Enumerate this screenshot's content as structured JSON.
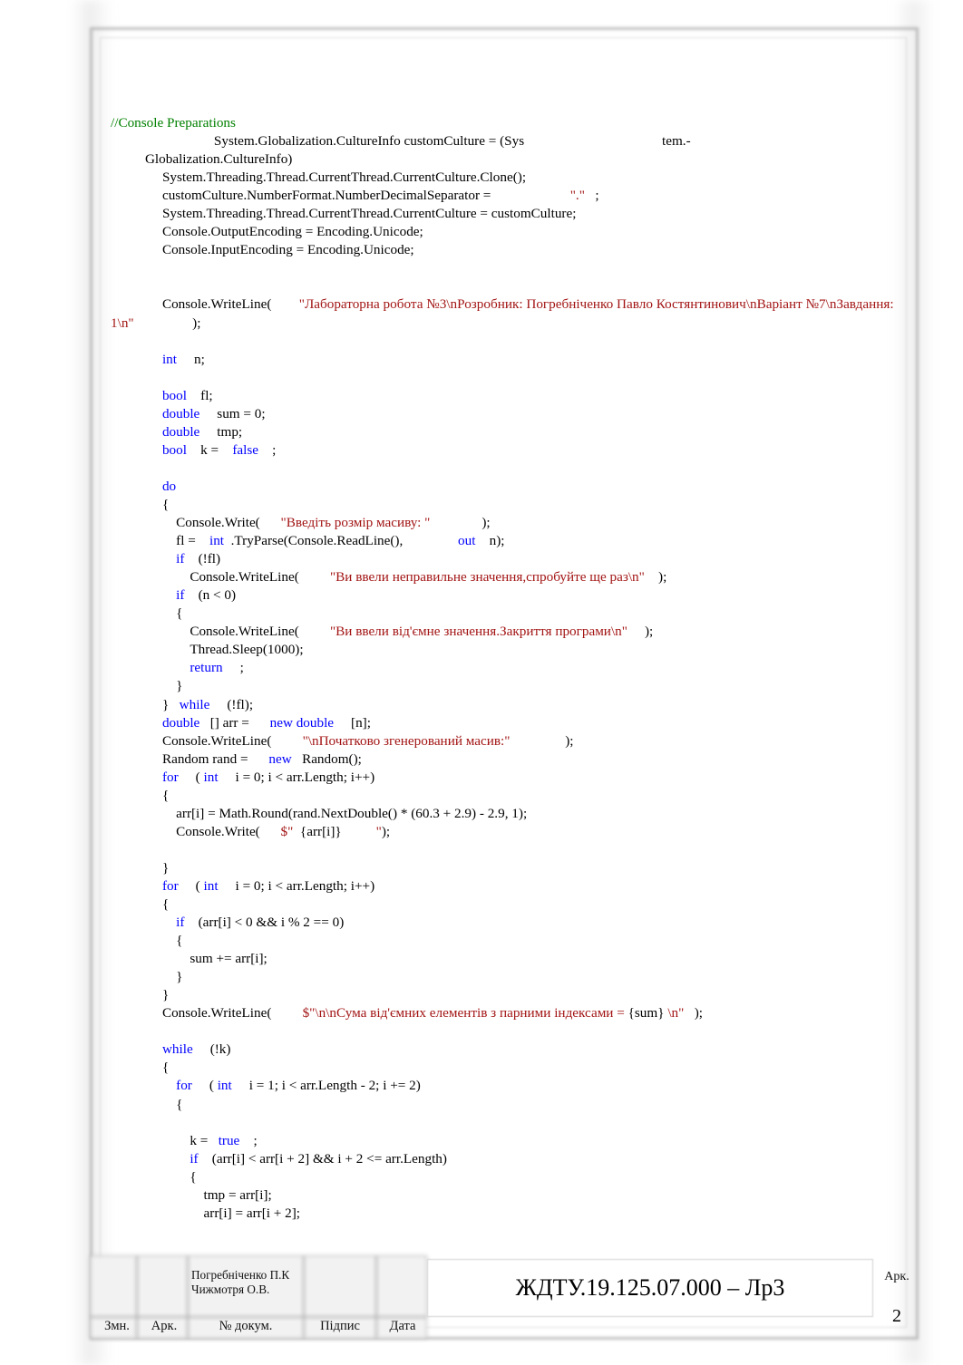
{
  "document": {
    "page_number": "2",
    "colors": {
      "keyword": "#0000ff",
      "string": "#a31515",
      "comment": "#008000",
      "plain": "#000000"
    }
  },
  "code": {
    "lines": [
      [
        {
          "t": "cmt",
          "s": "//Console Preparations"
        }
      ],
      [
        {
          "t": "pln",
          "s": "                              System.Globalization.CultureInfo customCulture = (Sys"
        },
        {
          "t": "pln",
          "s": "                                        tem.-"
        }
      ],
      [
        {
          "t": "pln",
          "s": "          Globalization.CultureInfo)"
        }
      ],
      [
        {
          "t": "pln",
          "s": "               System.Threading.Thread.CurrentThread.CurrentCulture.Clone();"
        }
      ],
      [
        {
          "t": "pln",
          "s": "               customCulture.NumberFormat.NumberDecimalSeparator = "
        },
        {
          "t": "str",
          "s": "                      \".\""
        },
        {
          "t": "pln",
          "s": "   ;"
        }
      ],
      [
        {
          "t": "pln",
          "s": "               System.Threading.Thread.CurrentThread.CurrentCulture = customCulture;"
        }
      ],
      [
        {
          "t": "pln",
          "s": "               Console.OutputEncoding = Encoding.Unicode;"
        }
      ],
      [
        {
          "t": "pln",
          "s": "               Console.InputEncoding = Encoding.Unicode;"
        }
      ],
      [],
      [],
      [
        {
          "t": "pln",
          "s": "               Console.WriteLine("
        },
        {
          "t": "str",
          "s": "        \"Лабораторна робота №3\\nРозробник: Погребніченко Павло Костянтинович\\nВаріант №7\\nЗавдання: 1\\n\""
        },
        {
          "t": "pln",
          "s": "                 );"
        }
      ],
      [],
      [
        {
          "t": "kw",
          "s": "               int"
        },
        {
          "t": "pln",
          "s": "     n;"
        }
      ],
      [],
      [
        {
          "t": "kw",
          "s": "               bool"
        },
        {
          "t": "pln",
          "s": "    fl;"
        }
      ],
      [
        {
          "t": "kw",
          "s": "               double"
        },
        {
          "t": "pln",
          "s": "     sum = 0;"
        }
      ],
      [
        {
          "t": "kw",
          "s": "               double"
        },
        {
          "t": "pln",
          "s": "     tmp;"
        }
      ],
      [
        {
          "t": "kw",
          "s": "               bool"
        },
        {
          "t": "pln",
          "s": "    k = "
        },
        {
          "t": "kw",
          "s": "   false"
        },
        {
          "t": "pln",
          "s": "    ;"
        }
      ],
      [],
      [
        {
          "t": "kw",
          "s": "               do"
        }
      ],
      [
        {
          "t": "pln",
          "s": "               {"
        }
      ],
      [
        {
          "t": "pln",
          "s": "                   Console.Write("
        },
        {
          "t": "str",
          "s": "      \"Введіть розмір масиву: \""
        },
        {
          "t": "pln",
          "s": "               );"
        }
      ],
      [
        {
          "t": "pln",
          "s": "                   fl = "
        },
        {
          "t": "kw",
          "s": "   int"
        },
        {
          "t": "pln",
          "s": "  .TryParse(Console.ReadLine(),                "
        },
        {
          "t": "kw",
          "s": "out"
        },
        {
          "t": "pln",
          "s": "    n);"
        }
      ],
      [
        {
          "t": "kw",
          "s": "                   if"
        },
        {
          "t": "pln",
          "s": "    (!fl)"
        }
      ],
      [
        {
          "t": "pln",
          "s": "                       Console.WriteLine("
        },
        {
          "t": "str",
          "s": "         \"Ви ввели неправильне значення,спробуйте ще раз\\n\""
        },
        {
          "t": "pln",
          "s": "    );"
        }
      ],
      [
        {
          "t": "kw",
          "s": "                   if"
        },
        {
          "t": "pln",
          "s": "    (n < 0)"
        }
      ],
      [
        {
          "t": "pln",
          "s": "                   {"
        }
      ],
      [
        {
          "t": "pln",
          "s": "                       Console.WriteLine("
        },
        {
          "t": "str",
          "s": "         \"Ви ввели від'ємне значення.Закриття програми\\n\""
        },
        {
          "t": "pln",
          "s": "     );"
        }
      ],
      [
        {
          "t": "pln",
          "s": "                       Thread.Sleep(1000);"
        }
      ],
      [
        {
          "t": "kw",
          "s": "                       return"
        },
        {
          "t": "pln",
          "s": "     ;"
        }
      ],
      [
        {
          "t": "pln",
          "s": "                   }"
        }
      ],
      [
        {
          "t": "pln",
          "s": "               } "
        },
        {
          "t": "kw",
          "s": "  while"
        },
        {
          "t": "pln",
          "s": "     (!fl);"
        }
      ],
      [
        {
          "t": "kw",
          "s": "               double"
        },
        {
          "t": "pln",
          "s": "   [] arr = "
        },
        {
          "t": "kw",
          "s": "     new double"
        },
        {
          "t": "pln",
          "s": "     [n];"
        }
      ],
      [
        {
          "t": "pln",
          "s": "               Console.WriteLine("
        },
        {
          "t": "str",
          "s": "         \"\\nПочатково згенерований масив:\""
        },
        {
          "t": "pln",
          "s": "                );"
        }
      ],
      [
        {
          "t": "pln",
          "s": "               Random rand = "
        },
        {
          "t": "kw",
          "s": "     new"
        },
        {
          "t": "pln",
          "s": "   Random();"
        }
      ],
      [
        {
          "t": "kw",
          "s": "               for"
        },
        {
          "t": "pln",
          "s": "     ( "
        },
        {
          "t": "kw",
          "s": "int"
        },
        {
          "t": "pln",
          "s": "     i = 0; i < arr.Length; i++)"
        }
      ],
      [
        {
          "t": "pln",
          "s": "               {"
        }
      ],
      [
        {
          "t": "pln",
          "s": "                   arr[i] = Math.Round(rand.NextDouble() * (60.3 + 2.9) - 2.9, 1);"
        }
      ],
      [
        {
          "t": "pln",
          "s": "                   Console.Write("
        },
        {
          "t": "str",
          "s": "      $\""
        },
        {
          "t": "pln",
          "s": "  {arr[i]}"
        },
        {
          "t": "str",
          "s": "          \""
        },
        {
          "t": "pln",
          "s": ");"
        }
      ],
      [],
      [
        {
          "t": "pln",
          "s": "               }"
        }
      ],
      [
        {
          "t": "kw",
          "s": "               for"
        },
        {
          "t": "pln",
          "s": "     ( "
        },
        {
          "t": "kw",
          "s": "int"
        },
        {
          "t": "pln",
          "s": "     i = 0; i < arr.Length; i++)"
        }
      ],
      [
        {
          "t": "pln",
          "s": "               {"
        }
      ],
      [
        {
          "t": "kw",
          "s": "                   if"
        },
        {
          "t": "pln",
          "s": "    (arr[i] < 0 && i % 2 == 0)"
        }
      ],
      [
        {
          "t": "pln",
          "s": "                   {"
        }
      ],
      [
        {
          "t": "pln",
          "s": "                       sum += arr[i];"
        }
      ],
      [
        {
          "t": "pln",
          "s": "                   }"
        }
      ],
      [
        {
          "t": "pln",
          "s": "               }"
        }
      ],
      [
        {
          "t": "pln",
          "s": "               Console.WriteLine("
        },
        {
          "t": "str",
          "s": "         $\"\\n\\nСума від'ємних елементів з парними індексами = "
        },
        {
          "t": "pln",
          "s": "{sum} "
        },
        {
          "t": "str",
          "s": "\\n\""
        },
        {
          "t": "pln",
          "s": "   );"
        }
      ],
      [],
      [
        {
          "t": "kw",
          "s": "               while"
        },
        {
          "t": "pln",
          "s": "     (!k)"
        }
      ],
      [
        {
          "t": "pln",
          "s": "               {"
        }
      ],
      [
        {
          "t": "kw",
          "s": "                   for"
        },
        {
          "t": "pln",
          "s": "     ( "
        },
        {
          "t": "kw",
          "s": "int"
        },
        {
          "t": "pln",
          "s": "     i = 1; i < arr.Length - 2; i += 2)"
        }
      ],
      [
        {
          "t": "pln",
          "s": "                   {"
        }
      ],
      [],
      [
        {
          "t": "pln",
          "s": "                       k = "
        },
        {
          "t": "kw",
          "s": "  true"
        },
        {
          "t": "pln",
          "s": "    ;"
        }
      ],
      [
        {
          "t": "kw",
          "s": "                       if"
        },
        {
          "t": "pln",
          "s": "    (arr[i] < arr[i + 2] && i + 2 <= arr.Length)"
        }
      ],
      [
        {
          "t": "pln",
          "s": "                       {"
        }
      ],
      [
        {
          "t": "pln",
          "s": "                           tmp = arr[i];"
        }
      ],
      [
        {
          "t": "pln",
          "s": "                           arr[i] = arr[i + 2];"
        }
      ]
    ]
  },
  "title_block": {
    "headers": {
      "change": "Змн.",
      "sheet": "Арк.",
      "doc_number": "№ докум.",
      "signature": "Підпис",
      "date": "Дата"
    },
    "names": "Погребніченко П.К\nЧижмотря О.В.",
    "main_code": "ЖДТУ.19.125.07.000 – Лр3",
    "page_label": "Арк.",
    "page_value": "2"
  }
}
